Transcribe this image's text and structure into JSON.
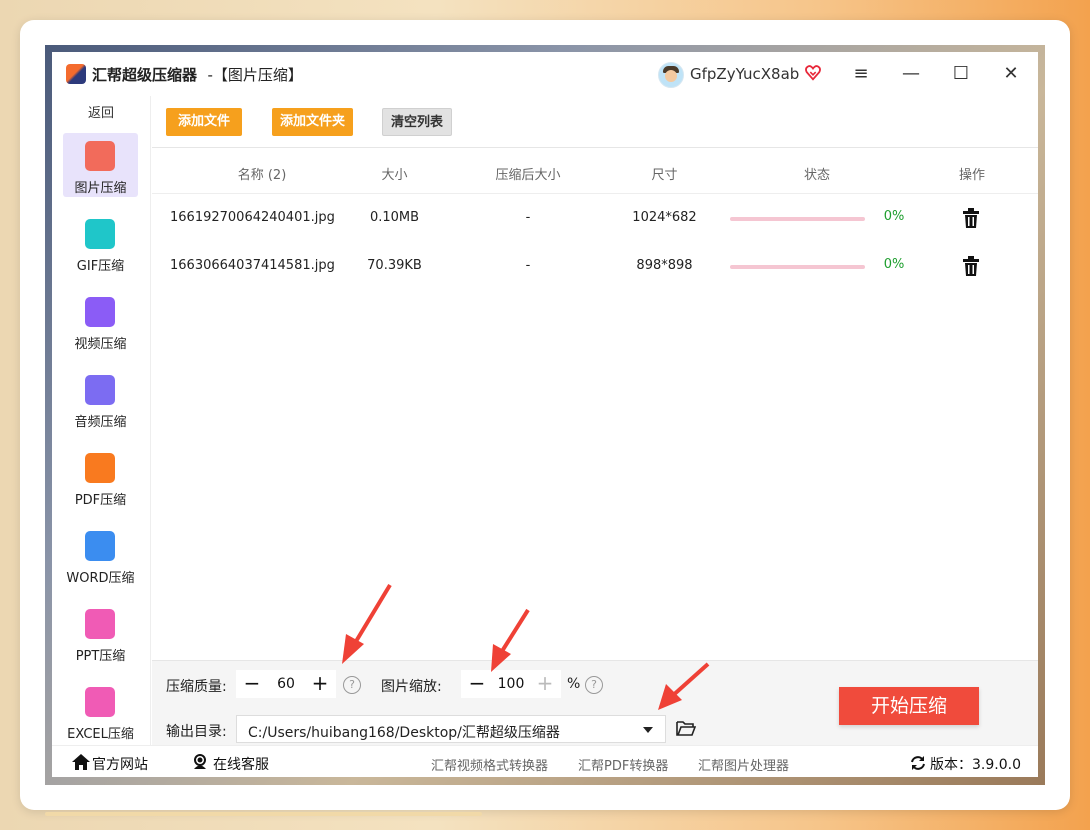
{
  "window": {
    "app_name": "汇帮超级压缩器",
    "mode": "-【图片压缩】",
    "username": "GfpZyYucX8ab",
    "controls": {
      "menu": "≡",
      "minimize": "—",
      "maximize": "☐",
      "close": "✕"
    }
  },
  "sidebar": {
    "back_label": "返回",
    "items": [
      {
        "label": "图片压缩",
        "icon": "image-icon",
        "color": "#f26b5b"
      },
      {
        "label": "GIF压缩",
        "icon": "gif-icon",
        "color": "#1fc6c9"
      },
      {
        "label": "视频压缩",
        "icon": "video-icon",
        "color": "#8b5cf6"
      },
      {
        "label": "音频压缩",
        "icon": "audio-icon",
        "color": "#7c6cf2"
      },
      {
        "label": "PDF压缩",
        "icon": "pdf-icon",
        "color": "#f97a1f"
      },
      {
        "label": "WORD压缩",
        "icon": "word-icon",
        "color": "#3b8df0"
      },
      {
        "label": "PPT压缩",
        "icon": "ppt-icon",
        "color": "#f05bb5"
      },
      {
        "label": "EXCEL压缩",
        "icon": "excel-icon",
        "color": "#f05bb5"
      }
    ]
  },
  "toolbar": {
    "add_file": "添加文件",
    "add_folder": "添加文件夹",
    "clear_list": "清空列表"
  },
  "table": {
    "headers": [
      "名称 (2)",
      "大小",
      "压缩后大小",
      "尺寸",
      "状态",
      "操作"
    ],
    "rows": [
      {
        "name": "16619270064240401.jpg",
        "size": "0.10MB",
        "compressed": "-",
        "dimension": "1024*682",
        "progress": "0%"
      },
      {
        "name": "16630664037414581.jpg",
        "size": "70.39KB",
        "compressed": "-",
        "dimension": "898*898",
        "progress": "0%"
      }
    ]
  },
  "settings": {
    "quality_label": "压缩质量:",
    "quality_value": "60",
    "scale_label": "图片缩放:",
    "scale_value": "100",
    "scale_unit": "%",
    "output_label": "输出目录:",
    "output_path": "C:/Users/huibang168/Desktop/汇帮超级压缩器",
    "start_button": "开始压缩"
  },
  "footer": {
    "website": "官方网站",
    "support": "在线客服",
    "links": [
      "汇帮视频格式转换器",
      "汇帮PDF转换器",
      "汇帮图片处理器"
    ],
    "version": "版本：3.9.0.0"
  },
  "colors": {
    "accent_orange": "#f6a01d",
    "start_red": "#f04b3c",
    "progress_pink": "#f5c6d2",
    "percent_green": "#1e9e2e",
    "arrow_red": "#ef4136"
  }
}
